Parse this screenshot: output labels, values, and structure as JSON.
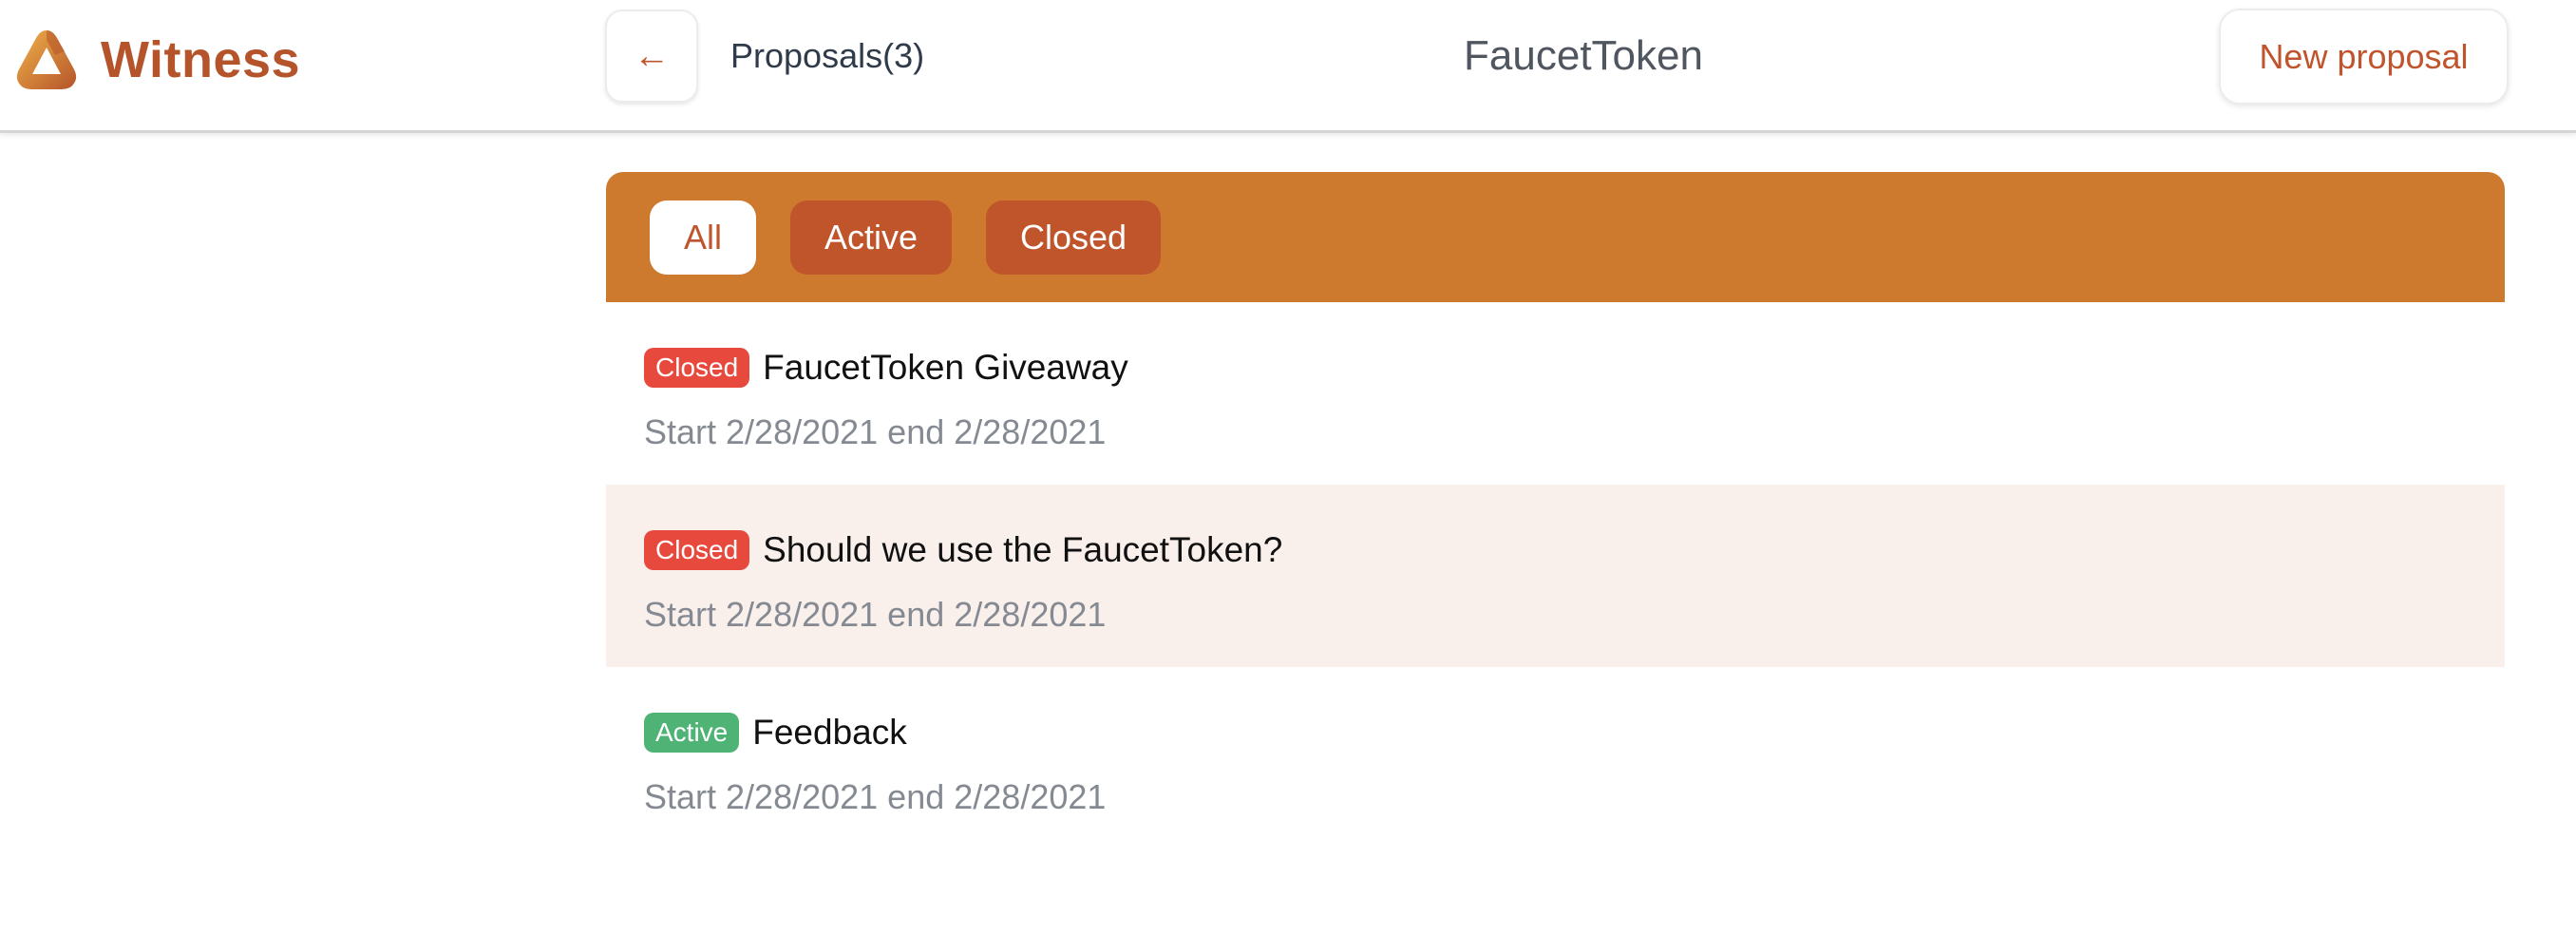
{
  "header": {
    "app_name": "Witness",
    "back_icon": "arrow-left-icon",
    "back_glyph": "←",
    "proposals_count": "Proposals(3)",
    "space_title": "FaucetToken",
    "new_proposal_label": "New proposal"
  },
  "filters": {
    "tabs": [
      {
        "label": "All",
        "selected": true
      },
      {
        "label": "Active",
        "selected": false
      },
      {
        "label": "Closed",
        "selected": false
      }
    ]
  },
  "proposals": [
    {
      "status": "Closed",
      "title": "FaucetToken Giveaway",
      "dates": "Start 2/28/2021 end 2/28/2021"
    },
    {
      "status": "Closed",
      "title": "Should we use the FaucetToken?",
      "dates": "Start 2/28/2021 end 2/28/2021"
    },
    {
      "status": "Active",
      "title": "Feedback",
      "dates": "Start 2/28/2021 end 2/28/2021"
    }
  ],
  "colors": {
    "brand": "#b5542a",
    "accent": "#c0552d",
    "filter_bar": "#cd7a2f",
    "filter_tab": "#c0542b",
    "badge_closed": "#e7493d",
    "badge_active": "#4fb375",
    "row_highlight": "#f9f0ec"
  }
}
